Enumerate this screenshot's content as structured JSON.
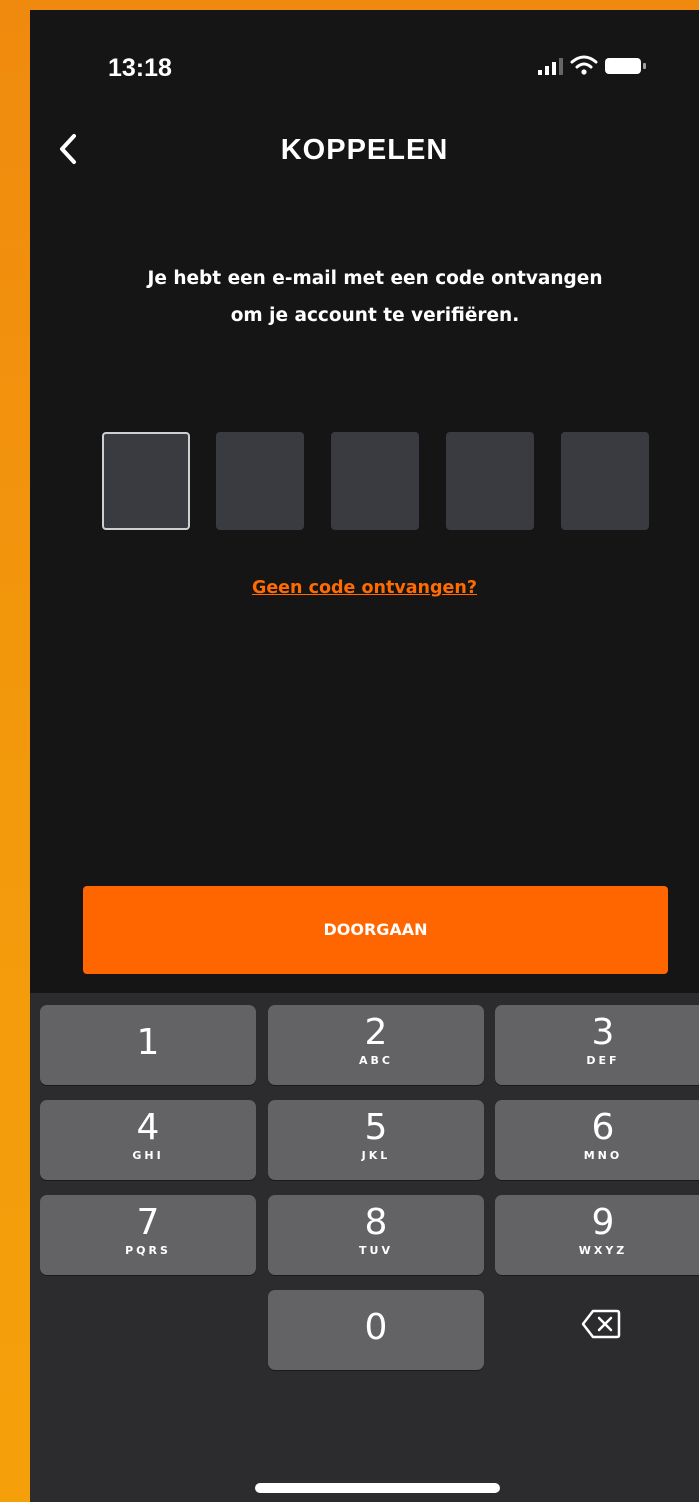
{
  "status_bar": {
    "time": "13:18"
  },
  "header": {
    "title": "KOPPELEN",
    "back_icon": "chevron-left-icon"
  },
  "message": {
    "line1": "Je hebt een e-mail met een code ontvangen",
    "line2": "om je account te verifiëren."
  },
  "code_input": {
    "values": [
      "",
      "",
      "",
      "",
      ""
    ]
  },
  "resend_link": "Geen code ontvangen?",
  "continue_button": "DOORGAAN",
  "keypad": {
    "keys": [
      {
        "digit": "1",
        "letters": ""
      },
      {
        "digit": "2",
        "letters": "ABC"
      },
      {
        "digit": "3",
        "letters": "DEF"
      },
      {
        "digit": "4",
        "letters": "GHI"
      },
      {
        "digit": "5",
        "letters": "JKL"
      },
      {
        "digit": "6",
        "letters": "MNO"
      },
      {
        "digit": "7",
        "letters": "PQRS"
      },
      {
        "digit": "8",
        "letters": "TUV"
      },
      {
        "digit": "9",
        "letters": "WXYZ"
      },
      {
        "digit": "0",
        "letters": ""
      }
    ],
    "delete_icon": "backspace-icon"
  },
  "colors": {
    "accent": "#ff6600",
    "background": "#151515",
    "key": "#636366",
    "keyboard_bg": "#2c2c2e",
    "code_box": "#3a3b40"
  }
}
